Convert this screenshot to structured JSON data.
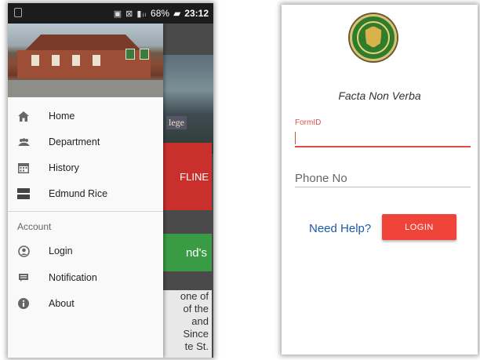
{
  "left_screen": {
    "status_bar": {
      "icons": "▣ ⊠ ▮ᵢₗ",
      "battery": "68%",
      "time": "23:12"
    },
    "drawer": {
      "items": [
        {
          "label": "Home",
          "icon": "home-icon"
        },
        {
          "label": "Department",
          "icon": "people-icon"
        },
        {
          "label": "History",
          "icon": "calendar-icon"
        },
        {
          "label": "Edmund Rice",
          "icon": "list-icon"
        }
      ],
      "section_label": "Account",
      "account_items": [
        {
          "label": "Login",
          "icon": "account-circle-icon"
        },
        {
          "label": "Notification",
          "icon": "message-icon"
        },
        {
          "label": "About",
          "icon": "info-icon"
        }
      ]
    },
    "background": {
      "college_fragment": "lege",
      "red_card_fragment": "FLINE",
      "green_card_fragment": "nd's",
      "text_lines": [
        "one of",
        "of  the",
        "and",
        "Since",
        "te  St."
      ]
    }
  },
  "right_screen": {
    "motto": "Facta Non Verba",
    "form_id_label": "FormID",
    "form_id_value": "",
    "phone_placeholder": "Phone No",
    "help_link": "Need Help?",
    "login_button": "LOGIN",
    "accent_color": "#f0443b",
    "link_color": "#1a5aa8"
  }
}
